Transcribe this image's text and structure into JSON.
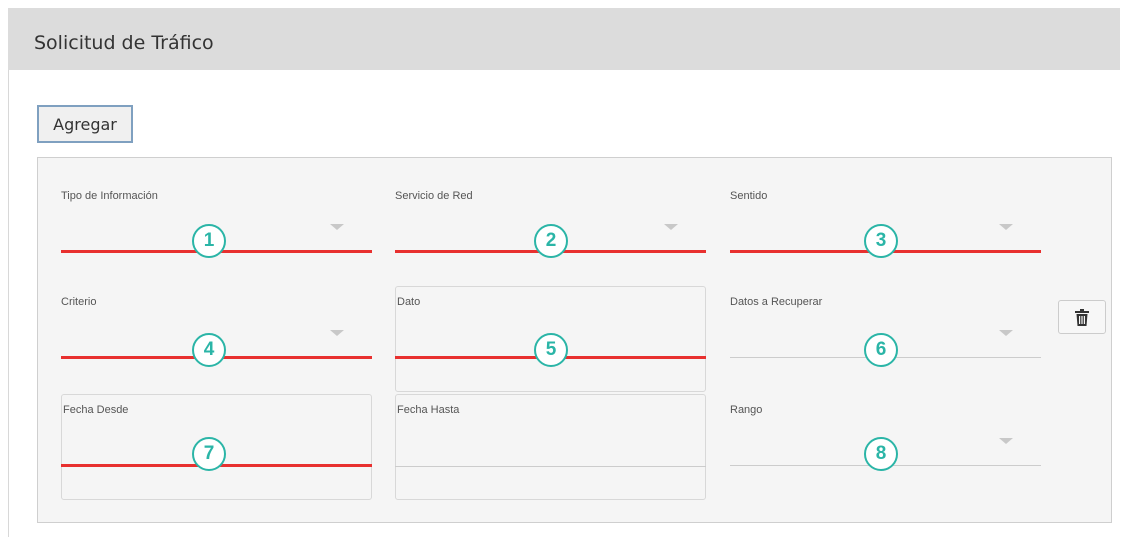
{
  "header": {
    "title": "Solicitud de Tráfico"
  },
  "toolbar": {
    "add_label": "Agregar"
  },
  "fields": {
    "tipo_informacion": {
      "label": "Tipo de Información",
      "badge": "1"
    },
    "servicio_red": {
      "label": "Servicio de Red",
      "badge": "2"
    },
    "sentido": {
      "label": "Sentido",
      "badge": "3"
    },
    "criterio": {
      "label": "Criterio",
      "badge": "4"
    },
    "dato": {
      "label": "Dato",
      "badge": "5"
    },
    "datos_recuperar": {
      "label": "Datos a Recuperar",
      "badge": "6"
    },
    "fecha_desde": {
      "label": "Fecha Desde",
      "badge": "7"
    },
    "fecha_hasta": {
      "label": "Fecha Hasta"
    },
    "rango": {
      "label": "Rango",
      "badge": "8"
    }
  },
  "colors": {
    "highlight_line": "#e8302f",
    "badge": "#2bb5a7",
    "header_bg": "#dcdcdc"
  },
  "icons": {
    "delete": "trash-icon"
  }
}
